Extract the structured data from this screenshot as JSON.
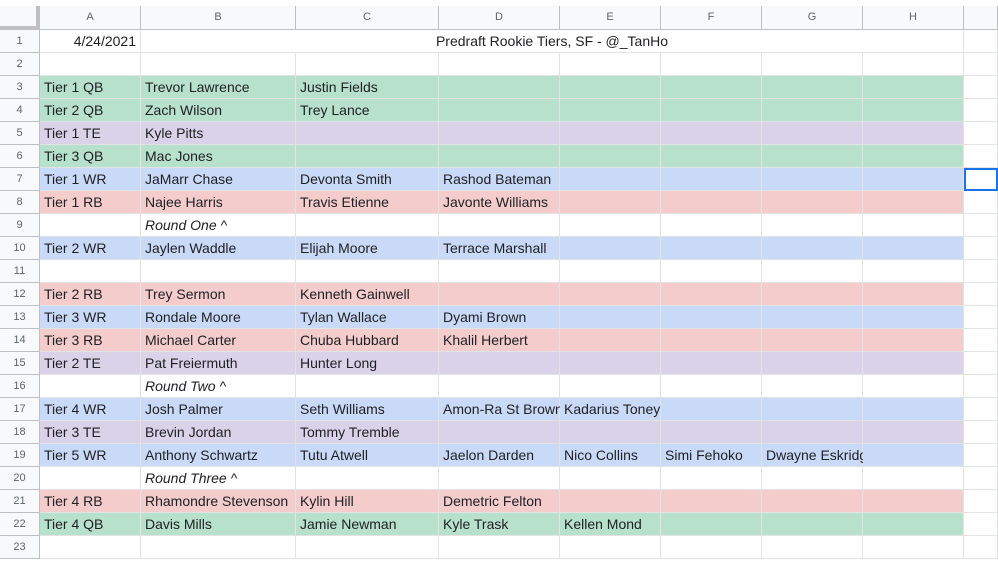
{
  "sheet": {
    "columns": [
      "A",
      "B",
      "C",
      "D",
      "E",
      "F",
      "G",
      "H"
    ],
    "row_numbers": [
      "1",
      "2",
      "3",
      "4",
      "5",
      "6",
      "7",
      "8",
      "9",
      "10",
      "11",
      "12",
      "13",
      "14",
      "15",
      "16",
      "17",
      "18",
      "19",
      "20",
      "21",
      "22",
      "23"
    ],
    "colors": {
      "qb": "#b7e1cd",
      "wr": "#c9daf8",
      "rb": "#f4cccc",
      "te": "#d9d2e9"
    },
    "rows": [
      {
        "type": "header",
        "cells": [
          "4/24/2021",
          "",
          "",
          "Predraft Rookie Tiers, SF - @_TanHo",
          "",
          "",
          "",
          ""
        ]
      },
      {
        "type": "blank",
        "cells": [
          "",
          "",
          "",
          "",
          "",
          "",
          "",
          ""
        ]
      },
      {
        "type": "qb",
        "cells": [
          "Tier 1 QB",
          "Trevor Lawrence",
          "Justin Fields",
          "",
          "",
          "",
          "",
          ""
        ]
      },
      {
        "type": "qb",
        "cells": [
          "Tier 2 QB",
          "Zach Wilson",
          "Trey Lance",
          "",
          "",
          "",
          "",
          ""
        ]
      },
      {
        "type": "te",
        "cells": [
          "Tier 1 TE",
          "Kyle Pitts",
          "",
          "",
          "",
          "",
          "",
          ""
        ]
      },
      {
        "type": "qb",
        "cells": [
          "Tier 3 QB",
          "Mac Jones",
          "",
          "",
          "",
          "",
          "",
          ""
        ]
      },
      {
        "type": "wr",
        "cells": [
          "Tier 1 WR",
          "JaMarr Chase",
          "Devonta Smith",
          "Rashod Bateman",
          "",
          "",
          "",
          ""
        ]
      },
      {
        "type": "rb",
        "cells": [
          "Tier 1 RB",
          "Najee Harris",
          "Travis Etienne",
          "Javonte Williams",
          "",
          "",
          "",
          ""
        ]
      },
      {
        "type": "round",
        "cells": [
          "",
          "Round One ^",
          "",
          "",
          "",
          "",
          "",
          ""
        ]
      },
      {
        "type": "wr",
        "cells": [
          "Tier 2 WR",
          "Jaylen Waddle",
          "Elijah Moore",
          "Terrace Marshall",
          "",
          "",
          "",
          ""
        ]
      },
      {
        "type": "blank",
        "cells": [
          "",
          "",
          "",
          "",
          "",
          "",
          "",
          ""
        ]
      },
      {
        "type": "rb",
        "cells": [
          "Tier 2 RB",
          "Trey Sermon",
          "Kenneth Gainwell",
          "",
          "",
          "",
          "",
          ""
        ]
      },
      {
        "type": "wr",
        "cells": [
          "Tier 3 WR",
          "Rondale Moore",
          "Tylan Wallace",
          "Dyami Brown",
          "",
          "",
          "",
          ""
        ]
      },
      {
        "type": "rb",
        "cells": [
          "Tier 3 RB",
          "Michael Carter",
          "Chuba Hubbard",
          "Khalil Herbert",
          "",
          "",
          "",
          ""
        ]
      },
      {
        "type": "te",
        "cells": [
          "Tier 2 TE",
          "Pat Freiermuth",
          "Hunter Long",
          "",
          "",
          "",
          "",
          ""
        ]
      },
      {
        "type": "round",
        "cells": [
          "",
          "Round Two ^",
          "",
          "",
          "",
          "",
          "",
          ""
        ]
      },
      {
        "type": "wr",
        "cells": [
          "Tier 4 WR",
          "Josh Palmer",
          "Seth Williams",
          "Amon-Ra St Brown",
          "Kadarius Toney",
          "",
          "",
          ""
        ]
      },
      {
        "type": "te",
        "cells": [
          "Tier 3 TE",
          "Brevin Jordan",
          "Tommy Tremble",
          "",
          "",
          "",
          "",
          ""
        ]
      },
      {
        "type": "wr",
        "cells": [
          "Tier 5 WR",
          "Anthony Schwartz",
          "Tutu Atwell",
          "Jaelon Darden",
          "Nico Collins",
          "Simi Fehoko",
          "Dwayne Eskridge",
          ""
        ]
      },
      {
        "type": "round",
        "cells": [
          "",
          "Round Three ^",
          "",
          "",
          "",
          "",
          "",
          ""
        ]
      },
      {
        "type": "rb",
        "cells": [
          "Tier 4 RB",
          "Rhamondre Stevenson",
          "Kylin Hill",
          "Demetric Felton",
          "",
          "",
          "",
          ""
        ]
      },
      {
        "type": "qb",
        "cells": [
          "Tier 4 QB",
          "Davis Mills",
          "Jamie Newman",
          "Kyle Trask",
          "Kellen Mond",
          "",
          "",
          ""
        ]
      },
      {
        "type": "blank",
        "cells": [
          "",
          "",
          "",
          "",
          "",
          "",
          "",
          ""
        ]
      }
    ]
  }
}
